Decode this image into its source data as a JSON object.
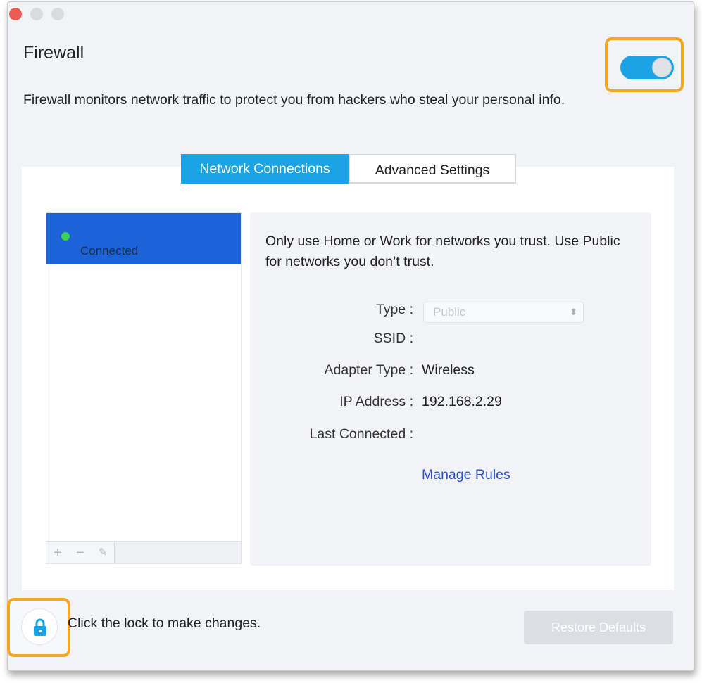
{
  "window": {
    "title": "Firewall",
    "description": "Firewall monitors network traffic to protect you from hackers who steal your personal info."
  },
  "firewall_toggle": {
    "state": "on"
  },
  "tabs": [
    {
      "label": "Network Connections",
      "active": true
    },
    {
      "label": "Advanced Settings",
      "active": false
    }
  ],
  "networks": [
    {
      "status": "Connected",
      "selected": true
    }
  ],
  "list_tools": {
    "add": "+",
    "remove": "−",
    "edit": "✎"
  },
  "details": {
    "hint": "Only use Home or Work for networks you trust. Use Public for networks you don’t trust.",
    "type_label": "Type :",
    "type_value": "Public",
    "ssid_label": "SSID :",
    "ssid_value": "",
    "adapter_label": "Adapter Type :",
    "adapter_value": "Wireless",
    "ip_label": "IP Address :",
    "ip_value": "192.168.2.29",
    "last_connected_label": "Last Connected :",
    "last_connected_value": "",
    "manage_rules": "Manage Rules"
  },
  "footer": {
    "lock_text": "Click the lock to make changes.",
    "restore_label": "Restore Defaults"
  },
  "colors": {
    "accent": "#1aa4e6",
    "selected_row": "#1d63d8",
    "connected_dot": "#3fcf56",
    "highlight": "#f5a623",
    "link": "#2b4fc9"
  },
  "icons": [
    "lock-icon",
    "plus-icon",
    "minus-icon",
    "pencil-icon",
    "select-arrows-icon"
  ]
}
